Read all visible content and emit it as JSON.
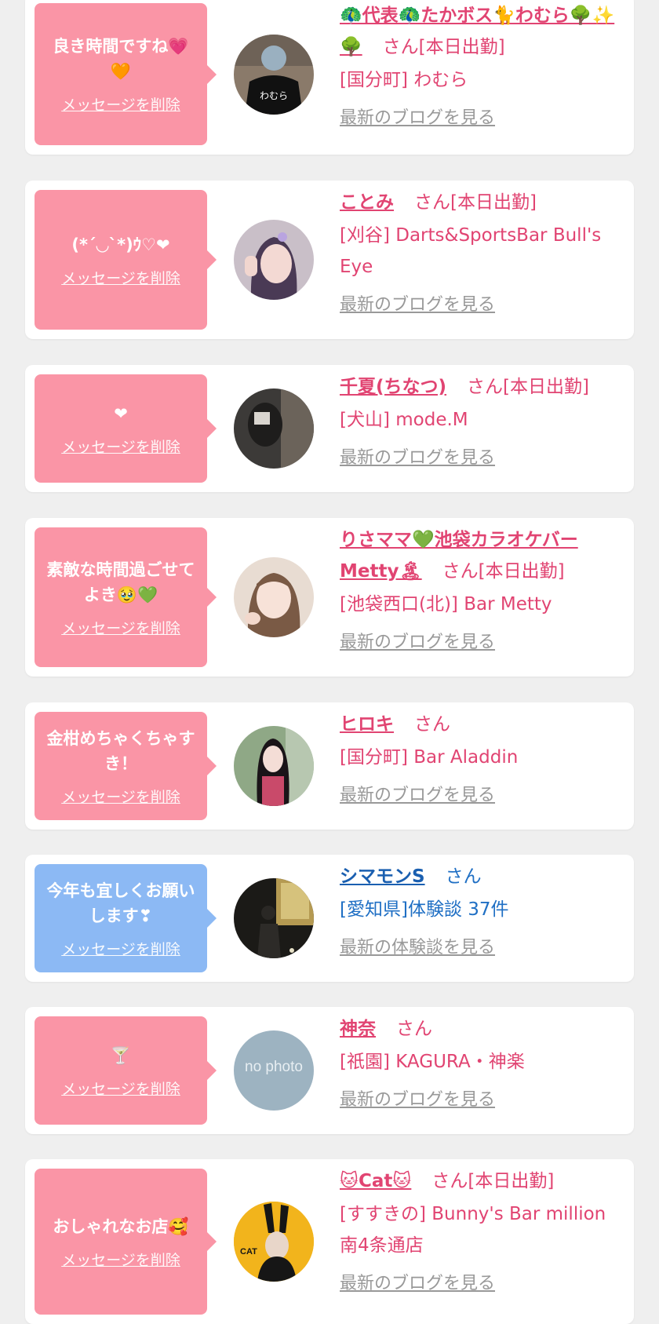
{
  "accent_pink": "#e14472",
  "bubble_pink": "#fa95a6",
  "bubble_blue": "#8cb9f4",
  "link_blue": "#1f6fc4",
  "delete_label": "メッセージを削除",
  "blog_label": "最新のブログを見る",
  "review_label": "最新の体験談を見る",
  "cards": [
    {
      "message": "良き時間ですね💗🧡",
      "name": "🦚代表🦚たかボス🐈わむら🌳✨🌳",
      "suffix": "さん[本日出勤]",
      "shop": "[国分町] わむら",
      "link": "最新のブログを見る",
      "avatar": "boss-jacket-photo"
    },
    {
      "message": "(*´◡`*)ｳ♡❤",
      "name": "ことみ",
      "suffix": "さん[本日出勤]",
      "shop": "[刈谷] Darts&SportsBar Bull's Eye",
      "link": "最新のブログを見る",
      "avatar": "girl-peace-sign-photo"
    },
    {
      "message": "❤",
      "name": "千夏(ちなつ)",
      "suffix": "さん[本日出勤]",
      "shop": "[犬山] mode.M",
      "link": "最新のブログを見る",
      "avatar": "dark-room-photo"
    },
    {
      "message": "素敵な時間過ごせてよき🥹💚",
      "name": "りさママ💚池袋カラオケバーMetty🏝",
      "suffix": "さん[本日出勤]",
      "shop": "[池袋西口(北)] Bar Metty",
      "link": "最新のブログを見る",
      "avatar": "smiling-girl-photo"
    },
    {
      "message": "金柑めちゃくちゃすき！",
      "name": "ヒロキ",
      "suffix": "さん",
      "shop": "[国分町] Bar Aladdin",
      "link": "最新のブログを見る",
      "avatar": "girl-outdoor-photo"
    },
    {
      "message": "今年も宜しくお願いします❣",
      "name": "シマモンS",
      "suffix": "さん",
      "shop": "[愛知県]体験談 37件",
      "link": "最新の体験談を見る",
      "avatar": "night-silhouette-photo"
    },
    {
      "message": "🍸",
      "name": "神奈",
      "suffix": "さん",
      "shop": "[祇園] KAGURA・神楽",
      "link": "最新のブログを見る",
      "avatar": "no-photo-placeholder",
      "avatar_text": "no photo"
    },
    {
      "message": "おしゃれなお店🥰",
      "name": "🐱Cat🐱",
      "suffix": "さん[本日出勤]",
      "shop": "[すすきの] Bunny's Bar million 南4条通店",
      "link": "最新のブログを見る",
      "avatar": "bunny-bar-magazine-photo",
      "avatar_text": "CAT"
    }
  ]
}
